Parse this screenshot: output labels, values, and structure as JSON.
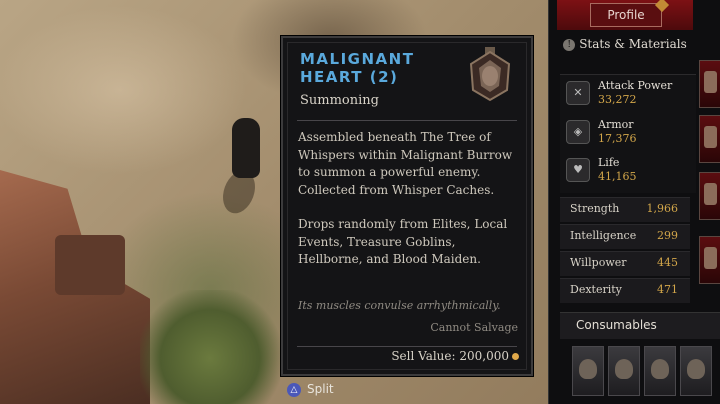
{
  "item": {
    "name": "MALIGNANT HEART (2)",
    "type": "Summoning",
    "description": [
      "Assembled beneath The Tree of Whispers within Malignant Burrow to summon a powerful enemy. Collected from Whisper Caches.",
      "Drops randomly from Elites, Local Events, Treasure Goblins, Hellborne, and Blood Maiden."
    ],
    "flavor": "Its muscles convulse arrhythmically.",
    "salvage": "Cannot Salvage",
    "sell_value": "Sell Value: 200,000",
    "icon": "malignant-heart-icon"
  },
  "prompt": {
    "split_label": "Split",
    "button_glyph": "△"
  },
  "panel": {
    "profile_label": "Profile",
    "stats_title": "Stats & Materials",
    "core_stats": [
      {
        "label": "Attack Power",
        "value": "33,272",
        "icon": "crossed-swords-icon"
      },
      {
        "label": "Armor",
        "value": "17,376",
        "icon": "shield-icon"
      },
      {
        "label": "Life",
        "value": "41,165",
        "icon": "heart-icon"
      }
    ],
    "attributes": [
      {
        "label": "Strength",
        "value": "1,966"
      },
      {
        "label": "Intelligence",
        "value": "299"
      },
      {
        "label": "Willpower",
        "value": "445"
      },
      {
        "label": "Dexterity",
        "value": "471"
      }
    ],
    "consumables_label": "Consumables"
  },
  "colors": {
    "item_name": "#5aa9dc",
    "stat_value": "#d2a64a",
    "profile_bg": "#7d1114"
  }
}
